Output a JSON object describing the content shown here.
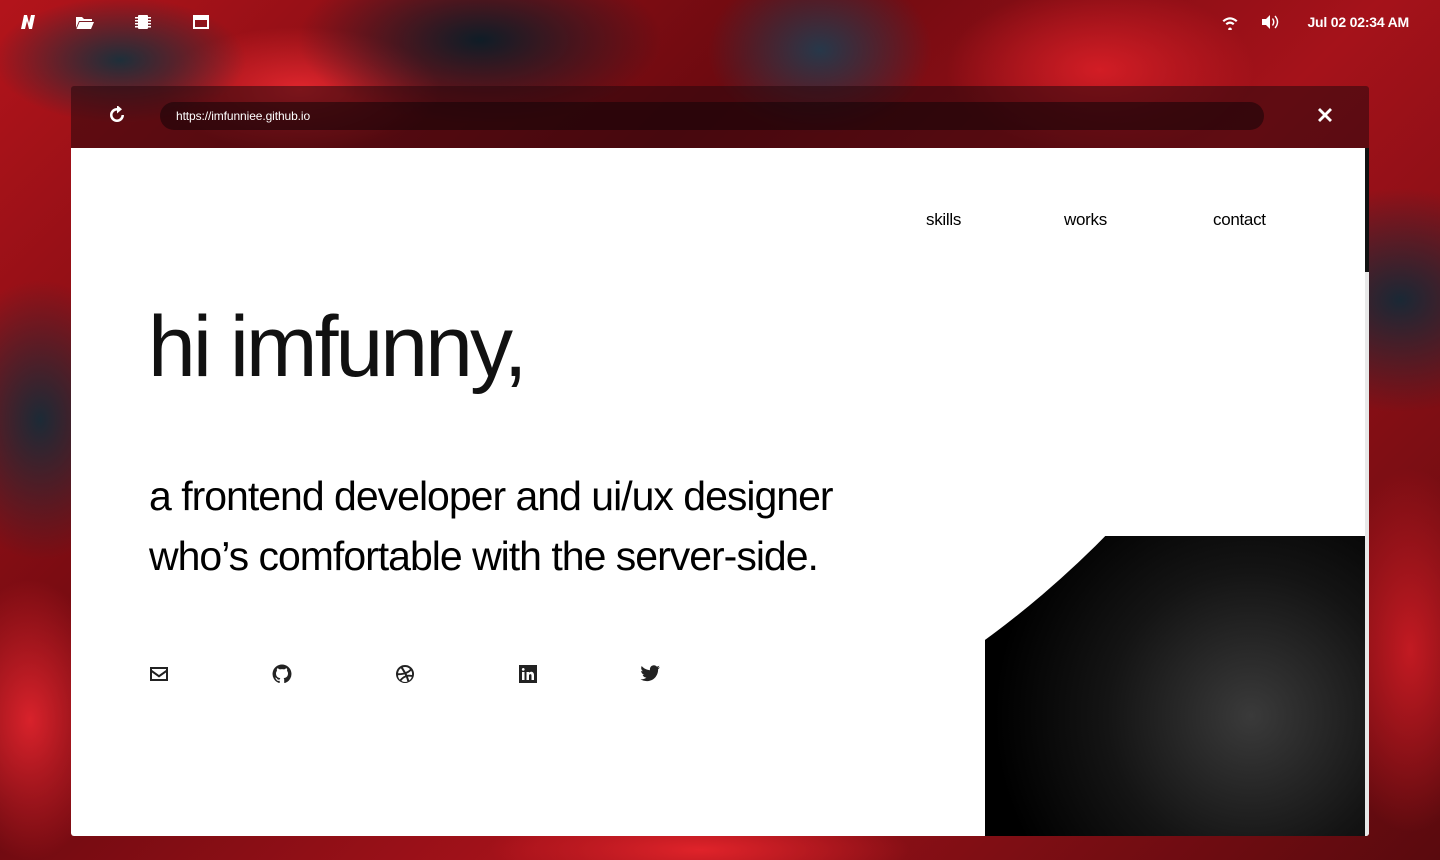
{
  "topbar": {
    "icons": [
      "logo-n-icon",
      "folder-icon",
      "chip-icon",
      "window-icon"
    ],
    "status_icons": [
      "wifi-icon",
      "volume-icon"
    ],
    "clock": "Jul 02 02:34 AM"
  },
  "browser": {
    "url": "https://imfunniee.github.io"
  },
  "page": {
    "nav": {
      "skills": "skills",
      "works": "works",
      "contact": "contact"
    },
    "hero": "hi imfunny,",
    "tagline_line1": "a frontend developer and ui/ux designer",
    "tagline_line2": "who’s comfortable with the server-side.",
    "social_icons": [
      "mail-icon",
      "github-icon",
      "dribbble-icon",
      "linkedin-icon",
      "twitter-icon"
    ]
  },
  "colors": {
    "wallpaper_red": "#b3141b",
    "wallpaper_dark": "#1e2f3a",
    "page_bg": "#ffffff",
    "text": "#111111"
  }
}
